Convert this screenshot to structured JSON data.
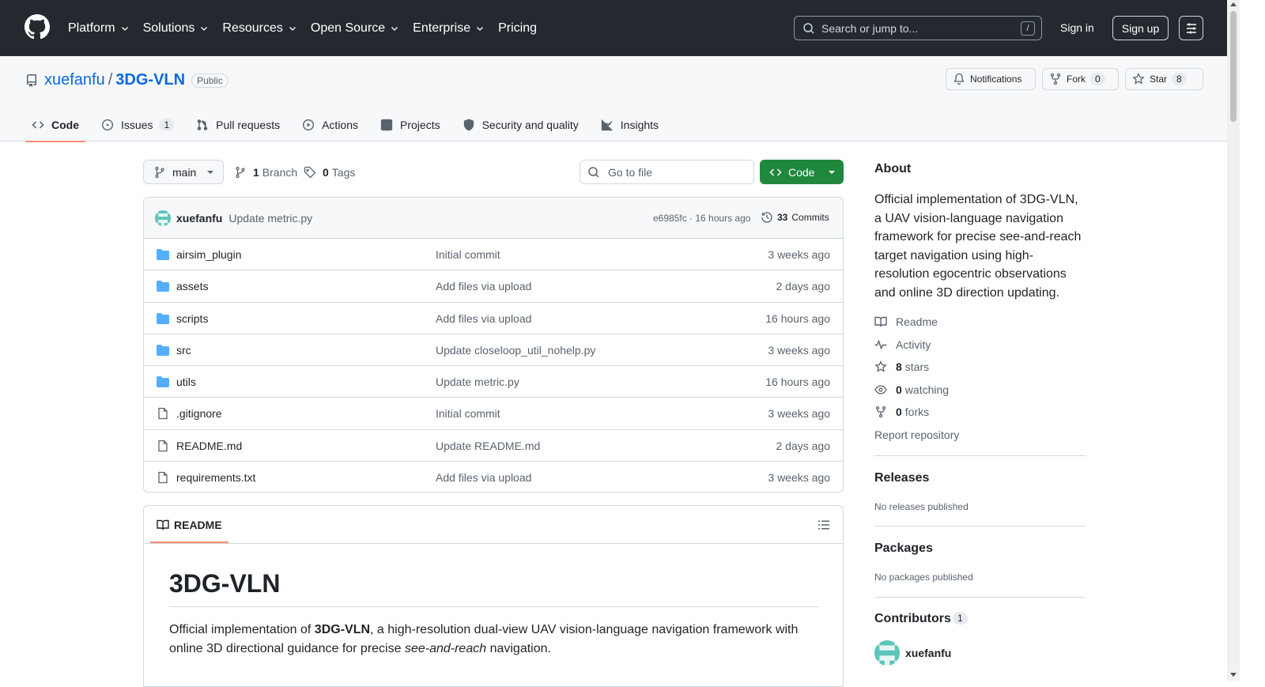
{
  "header": {
    "nav": [
      "Platform",
      "Solutions",
      "Resources",
      "Open Source",
      "Enterprise"
    ],
    "pricing": "Pricing",
    "search_placeholder": "Search or jump to...",
    "search_key": "/",
    "sign_in": "Sign in",
    "sign_up": "Sign up"
  },
  "repo": {
    "owner": "xuefanfu",
    "separator": "/",
    "name": "3DG-VLN",
    "visibility": "Public",
    "notifications_label": "Notifications",
    "fork_label": "Fork",
    "fork_count": "0",
    "star_label": "Star",
    "star_count": "8"
  },
  "tabs": [
    {
      "label": "Code",
      "icon": "code-icon",
      "active": true
    },
    {
      "label": "Issues",
      "icon": "issue-icon",
      "count": "1"
    },
    {
      "label": "Pull requests",
      "icon": "pull-request-icon"
    },
    {
      "label": "Actions",
      "icon": "play-icon"
    },
    {
      "label": "Projects",
      "icon": "table-icon"
    },
    {
      "label": "Security and quality",
      "icon": "shield-icon"
    },
    {
      "label": "Insights",
      "icon": "graph-icon"
    }
  ],
  "toolbar": {
    "branch": "main",
    "branch_count": "1",
    "branch_label": "Branch",
    "tag_count": "0",
    "tag_label": "Tags",
    "goto_placeholder": "Go to file",
    "code_button": "Code"
  },
  "commit": {
    "author": "xuefanfu",
    "message": "Update metric.py",
    "meta": "e6985fc · 16 hours ago",
    "commits_count": "33",
    "commits_label": "Commits"
  },
  "files": [
    {
      "name": "airsim_plugin",
      "type": "folder",
      "message": "Initial commit",
      "age": "3 weeks ago"
    },
    {
      "name": "assets",
      "type": "folder",
      "message": "Add files via upload",
      "age": "2 days ago"
    },
    {
      "name": "scripts",
      "type": "folder",
      "message": "Add files via upload",
      "age": "16 hours ago"
    },
    {
      "name": "src",
      "type": "folder",
      "message": "Update closeloop_util_nohelp.py",
      "age": "3 weeks ago"
    },
    {
      "name": "utils",
      "type": "folder",
      "message": "Update metric.py",
      "age": "16 hours ago"
    },
    {
      "name": ".gitignore",
      "type": "file",
      "message": "Initial commit",
      "age": "3 weeks ago"
    },
    {
      "name": "README.md",
      "type": "file",
      "message": "Update README.md",
      "age": "2 days ago"
    },
    {
      "name": "requirements.txt",
      "type": "file",
      "message": "Add files via upload",
      "age": "3 weeks ago"
    }
  ],
  "readme": {
    "tab_label": "README",
    "title": "3DG-VLN",
    "p_pre": "Official implementation of ",
    "p_bold": "3DG-VLN",
    "p_mid": ", a high-resolution dual-view UAV vision-language navigation framework with online 3D directional guidance for precise ",
    "p_italic": "see-and-reach",
    "p_post": " navigation."
  },
  "sidebar": {
    "about_title": "About",
    "about_desc": "Official implementation of 3DG-VLN, a UAV vision-language navigation framework for precise see-and-reach target navigation using high-resolution egocentric observations and online 3D direction updating.",
    "readme_link": "Readme",
    "activity_link": "Activity",
    "stars_count": "8",
    "stars_label": "stars",
    "watching_count": "0",
    "watching_label": "watching",
    "forks_count": "0",
    "forks_label": "forks",
    "report": "Report repository",
    "releases_title": "Releases",
    "releases_note": "No releases published",
    "packages_title": "Packages",
    "packages_note": "No packages published",
    "contributors_title": "Contributors",
    "contributors_count": "1",
    "contributor_name": "xuefanfu"
  },
  "colors": {
    "header_bg": "#24292f",
    "link": "#0969da",
    "primary_button": "#1f883d",
    "active_tab_underline": "#fd8c73",
    "folder_icon": "#54aeff"
  }
}
